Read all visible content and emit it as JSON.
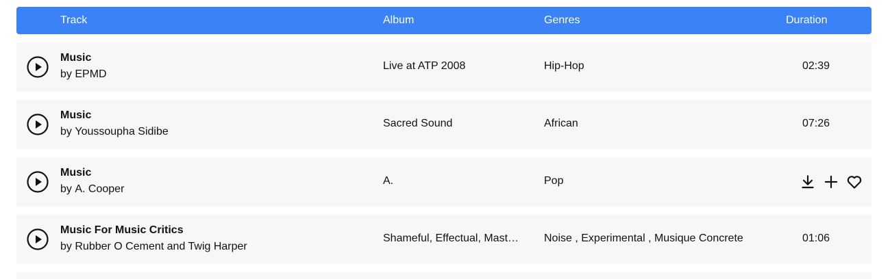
{
  "header": {
    "track": "Track",
    "album": "Album",
    "genres": "Genres",
    "duration": "Duration"
  },
  "colors": {
    "header_bg": "#3b82f6",
    "row_bg": "#f7f7f7"
  },
  "rows": [
    {
      "title": "Music",
      "by": "by",
      "artist": "EPMD",
      "album": "Live at ATP 2008",
      "genres": "Hip-Hop",
      "duration": "02:39",
      "hovered": false
    },
    {
      "title": "Music",
      "by": "by",
      "artist": "Youssoupha Sidibe",
      "album": "Sacred Sound",
      "genres": "African",
      "duration": "07:26",
      "hovered": false
    },
    {
      "title": "Music",
      "by": "by",
      "artist": "A. Cooper",
      "album": "A.",
      "genres": "Pop",
      "duration": "",
      "hovered": true,
      "actions": [
        "download-icon",
        "add-icon",
        "heart-icon"
      ]
    },
    {
      "title": "Music For Music Critics",
      "by": "by",
      "artist": "Rubber O Cement and Twig Harper",
      "album": "Shameful, Effectual, Masterful",
      "genres": "Noise , Experimental , Musique Concrete",
      "duration": "01:06",
      "hovered": false
    }
  ]
}
